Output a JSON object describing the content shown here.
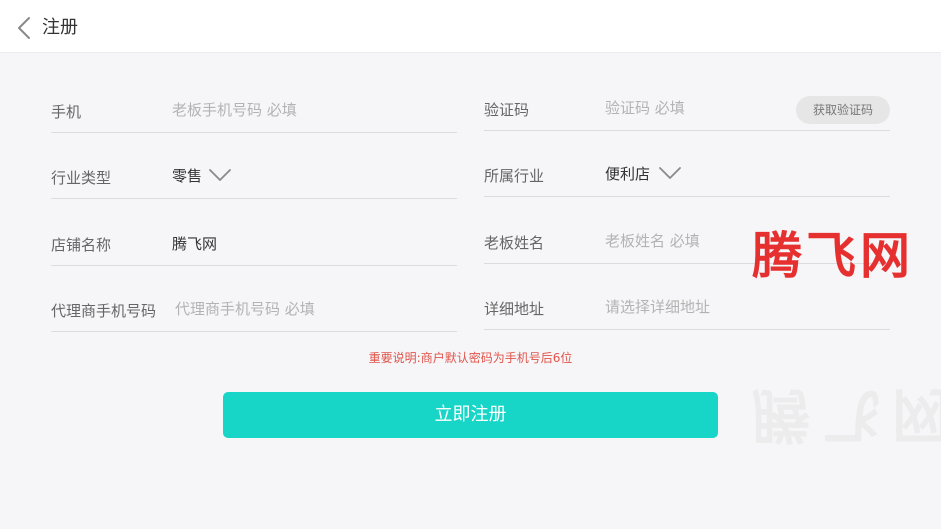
{
  "header": {
    "title": "注册",
    "back_icon": "chevron-left-icon"
  },
  "form": {
    "phone": {
      "label": "手机",
      "placeholder": "老板手机号码 必填",
      "value": ""
    },
    "code": {
      "label": "验证码",
      "placeholder": "验证码 必填",
      "value": "",
      "button_label": "获取验证码"
    },
    "industry_type": {
      "label": "行业类型",
      "value": "零售",
      "icon": "chevron-down-icon"
    },
    "industry": {
      "label": "所属行业",
      "value": "便利店",
      "icon": "chevron-down-icon"
    },
    "store_name": {
      "label": "店铺名称",
      "value": "腾飞网"
    },
    "owner_name": {
      "label": "老板姓名",
      "placeholder": "老板姓名 必填",
      "value": ""
    },
    "agent_phone": {
      "label": "代理商手机号码",
      "placeholder": "代理商手机号码 必填",
      "value": ""
    },
    "address": {
      "label": "详细地址",
      "placeholder": "请选择详细地址",
      "value": ""
    }
  },
  "notice": "重要说明:商户默认密码为手机号后6位",
  "submit_label": "立即注册",
  "watermark": "腾飞网",
  "colors": {
    "accent": "#17d6c7",
    "notice": "#e0544a",
    "watermark": "#e63030"
  }
}
